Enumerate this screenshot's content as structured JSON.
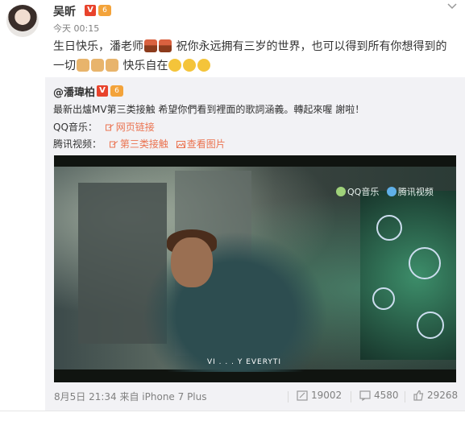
{
  "post": {
    "username": "吴昕",
    "verified_badge": "V",
    "level_badge": "6",
    "time": "今天 00:15",
    "content_line1": "生日快乐，潘老师",
    "content_line1b": "祝你永远拥有三岁的世界，也可以得到所有你想得到的",
    "content_line2a": "一切",
    "content_line2b": "快乐自在"
  },
  "repost": {
    "username": "@潘瑋柏",
    "verified_badge": "V",
    "level_badge": "6",
    "text": "最新出爐MV第三类接触 希望你們看到裡面的歌詞涵義。轉起來喔 謝啦！",
    "qq_label": "QQ音乐：",
    "qq_link": "网页链接",
    "tencent_label": "腾讯视频：",
    "tencent_link": "第三类接触",
    "view_images": "查看图片",
    "video": {
      "watermark_qq": "QQ音乐",
      "watermark_tencent": "腾讯视频",
      "caption": "VI . . . Y EVERYTI"
    },
    "meta": "8月5日 21:34 来自 iPhone 7 Plus",
    "reposts": "19002",
    "comments": "4580",
    "likes": "29268"
  },
  "colors": {
    "link": "#eb7350",
    "badge_red": "#e8432c",
    "badge_orange": "#f3a33a",
    "repost_bg": "#f2f2f5",
    "meta_gray": "#808080"
  },
  "icons": [
    "chevron-down-icon",
    "link-icon",
    "image-icon",
    "repost-icon",
    "comment-icon",
    "like-icon"
  ]
}
